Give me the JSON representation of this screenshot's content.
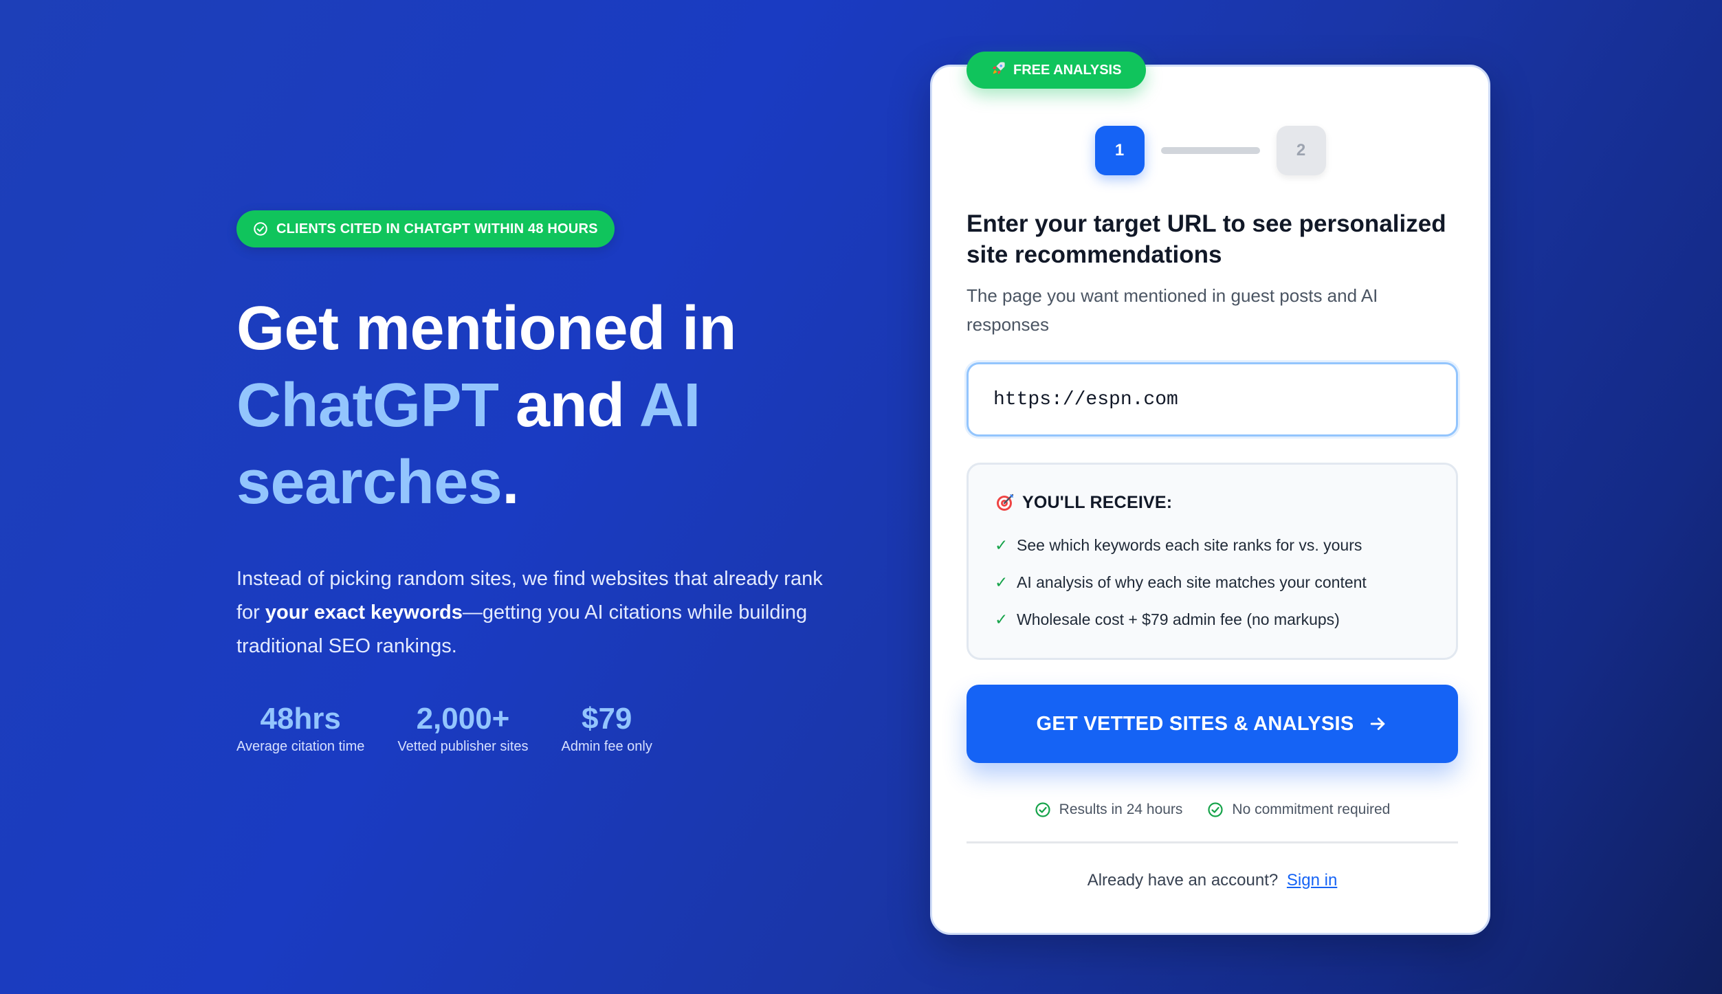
{
  "hero": {
    "badge": "CLIENTS CITED IN CHATGPT WITHIN 48 HOURS",
    "headline": {
      "part1": "Get mentioned in",
      "highlight1": "ChatGPT",
      "part2": " and ",
      "highlight2": "AI",
      "highlight3": "searches",
      "part3": "."
    },
    "subtext": {
      "before": "Instead of picking random sites, we find websites that already rank for ",
      "bold": "your exact keywords",
      "after": "—getting you AI citations while building traditional SEO rankings."
    },
    "stats": [
      {
        "value": "48hrs",
        "label": "Average citation time"
      },
      {
        "value": "2,000+",
        "label": "Vetted publisher sites"
      },
      {
        "value": "$79",
        "label": "Admin fee only"
      }
    ]
  },
  "card": {
    "badge": "FREE ANALYSIS",
    "badge_icon": "rocket-icon",
    "steps": [
      "1",
      "2"
    ],
    "active_step": "1",
    "title": "Enter your target URL to see personalized site recommendations",
    "description": "The page you want mentioned in guest posts and AI responses",
    "url_input": {
      "value": "https://espn.com",
      "placeholder": ""
    },
    "receive": {
      "title": "YOU'LL RECEIVE:",
      "icon": "target-icon",
      "items": [
        "See which keywords each site ranks for vs. yours",
        "AI analysis of why each site matches your content",
        "Wholesale cost + $79 admin fee (no markups)"
      ]
    },
    "cta_label": "GET VETTED SITES & ANALYSIS",
    "assurances": [
      "Results in 24 hours",
      "No commitment required"
    ],
    "signin_prompt": "Already have an account?",
    "signin_link": "Sign in"
  },
  "colors": {
    "accent_blue": "#1563f5",
    "green": "#10c45c",
    "highlight": "#93c5fd",
    "background_start": "#1d3fb8",
    "background_end": "#101f5e"
  }
}
